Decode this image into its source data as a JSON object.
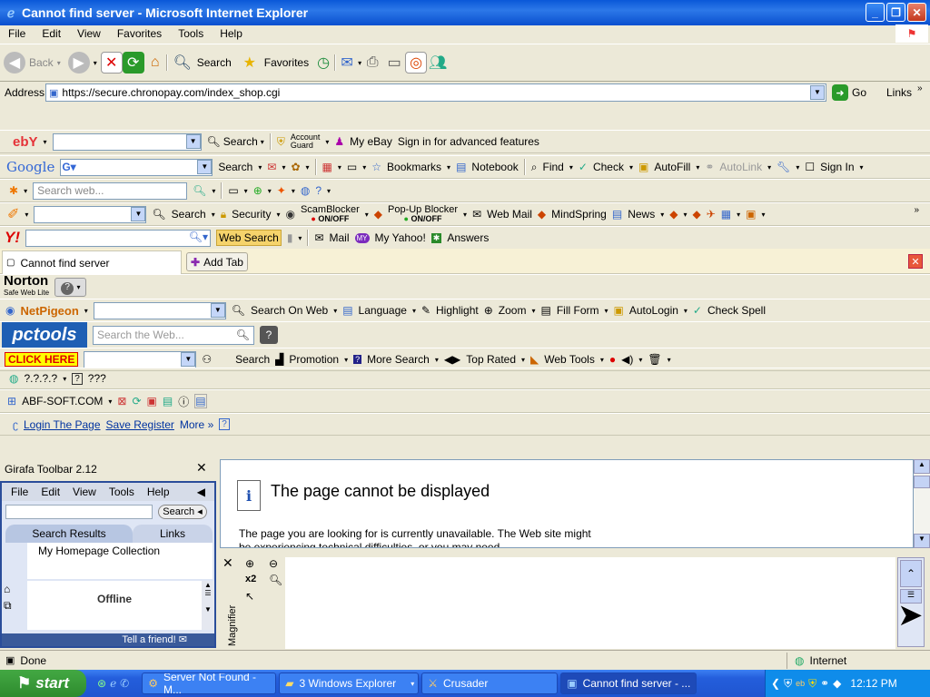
{
  "window": {
    "title": "Cannot find server - Microsoft Internet Explorer"
  },
  "menu": [
    "File",
    "Edit",
    "View",
    "Favorites",
    "Tools",
    "Help"
  ],
  "std_toolbar": {
    "back": "Back",
    "search": "Search",
    "favorites": "Favorites"
  },
  "address": {
    "label": "Address",
    "url": "https://secure.chronopay.com/index_shop.cgi",
    "go": "Go",
    "links": "Links"
  },
  "ebay": {
    "logo": "ebY",
    "search": "Search",
    "account_guard_1": "Account",
    "account_guard_2": "Guard",
    "my_ebay": "My eBay",
    "sign_in": "Sign in for advanced features"
  },
  "google": {
    "logo": "Google",
    "search": "Search",
    "bookmarks": "Bookmarks",
    "notebook": "Notebook",
    "find": "Find",
    "check": "Check",
    "autofill": "AutoFill",
    "autolink": "AutoLink",
    "signin": "Sign In"
  },
  "msn": {
    "placeholder": "Search web..."
  },
  "earthlink": {
    "search": "Search",
    "security": "Security",
    "scamblocker": "ScamBlocker",
    "scam_state_on": "ON",
    "scam_state_off": "/OFF",
    "popup": "Pop-Up Blocker",
    "popup_on": "ON",
    "popup_off": "/OFF",
    "webmail": "Web Mail",
    "mindspring": "MindSpring",
    "news": "News"
  },
  "yahoo": {
    "logo": "Y!",
    "web_search": "Web Search",
    "mail": "Mail",
    "my_yahoo": "My Yahoo!",
    "answers": "Answers"
  },
  "tabs": {
    "active": "Cannot find server",
    "add": "Add Tab"
  },
  "norton": {
    "logo": "Norton",
    "sub": "Safe Web Lite"
  },
  "netpigeon": {
    "logo": "NetPigeon",
    "search_on_web": "Search On Web",
    "language": "Language",
    "highlight": "Highlight",
    "zoom": "Zoom",
    "fill_form": "Fill Form",
    "autologin": "AutoLogin",
    "check_spell": "Check Spell"
  },
  "pctools": {
    "logo": "pctools",
    "placeholder": "Search the Web..."
  },
  "clickhere": {
    "logo": "CLICK HERE",
    "search": "Search",
    "promotion": "Promotion",
    "more_search": "More Search",
    "top_rated": "Top Rated",
    "web_tools": "Web Tools"
  },
  "unknown1": {
    "label1": "?.?.?.?",
    "label2": "???"
  },
  "abf": {
    "label": "ABF-SOFT.COM"
  },
  "login": {
    "login": "Login The Page",
    "save": "Save Register",
    "more": "More"
  },
  "girafa": {
    "title": "Girafa Toolbar 2.12",
    "menu": [
      "File",
      "Edit",
      "View",
      "Tools",
      "Help"
    ],
    "search": "Search",
    "tab_results": "Search Results",
    "tab_links": "Links",
    "collection": "My Homepage Collection",
    "offline": "Offline",
    "tell_friend": "Tell a friend!"
  },
  "page": {
    "heading": "The page cannot be displayed",
    "body": "The page you are looking for is currently unavailable. The Web site might be experiencing technical difficulties, or you may need"
  },
  "magnifier": {
    "label": "Magnifier",
    "x2": "x2"
  },
  "status": {
    "done": "Done",
    "zone": "Internet"
  },
  "taskbar": {
    "start": "start",
    "tasks": [
      "Server Not Found - M...",
      "3 Windows Explorer",
      "Crusader",
      "Cannot find server - ..."
    ],
    "time": "12:12 PM"
  }
}
